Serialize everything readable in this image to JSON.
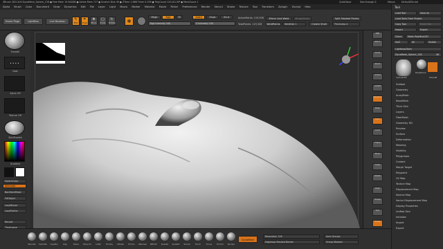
{
  "titlebar": {
    "text": "ZBrush 2021.6.6   DynaMesh_Sphere_128   ● Free Mem 19.900GB ● Active Mem 717 ● Scratch Disk 49 ● ZTime 1.866 Timer 0.299 ● PolyCount 120.014 KP ● MeshCount 1",
    "right": [
      "QuickSave",
      "See-through 0",
      "Menus",
      "DefaultZScript"
    ]
  },
  "menubar": [
    "Alpha",
    "Brush",
    "Color",
    "Document",
    "Draw",
    "Dynamics",
    "Edit",
    "File",
    "Layer",
    "Light",
    "Macro",
    "Marker",
    "Material",
    "Movie",
    "Picker",
    "Preferences",
    "Render",
    "Stencil",
    "Stroke",
    "Texture",
    "Tool",
    "Transform",
    "Zplugin",
    "Zscript",
    "Help"
  ],
  "toolbar": {
    "home_page": "Home Page",
    "lightbox": "LightBox",
    "live_boolean": "Live Boolean",
    "edit": "Edit",
    "draw": "Draw",
    "move": "Move",
    "scale": "Scale",
    "rotate": "Rotate",
    "mrgb": "Mrgb",
    "rgb": "Rgb",
    "m": "M",
    "zadd": "Zadd",
    "zsub": "Zsub",
    "zcut": "Zcut",
    "rgb_intensity": "Rgb Intensity 100",
    "z_intensity": "Z Intensity 100",
    "active_points": "ActivePoints: 119,528",
    "total_points": "TotalPoints: 119,528",
    "mirror_weld": "Mirror And Weld",
    "weld_points": "WeldPoints",
    "weld_dist": "WeldDist 1",
    "merge_down": "MergeDown",
    "create_shell": "Create Shell",
    "split_masked": "Split Masked Points",
    "thickness": "Thickness 4",
    "focal_shift": "Focal Shift 0",
    "draw_size": "Draw Size 64",
    "dynamic": "Dynamic"
  },
  "lefttray": {
    "brush_label": "Smooth",
    "stroke_label": "Dots",
    "alpha_label": "Alpha Off",
    "texture_label": "Texture Off",
    "material_label": "SkinShade4",
    "gradient_label": "Gradient",
    "switch_color": "SwitchColor",
    "alternate": "Alternate",
    "backface": "BackfaceMask",
    "flat_object": "FillObject",
    "lazy_mouse": "LazyMouse",
    "lazy_radius": "LazyRadius",
    "record": "Record",
    "timelapse": "TimeLapse",
    "turntable": "Turntable"
  },
  "rightshelf": [
    "BPR",
    "SPix 3",
    "Scroll",
    "Zoom",
    "Actual",
    "AAHalf",
    "Dynamic",
    "Persp",
    "Floor",
    "Local",
    "Frame",
    "Move",
    "Scale",
    "Rotate",
    "PolyF",
    "Transp",
    "Solo",
    "Xpose"
  ],
  "toolpal": {
    "title": "Tool",
    "load_tool": "Load Tool",
    "save_as": "Save As",
    "load_tools_project": "Load Tools From Project",
    "copy_tool": "Copy Tool",
    "paste_tool": "Paste Tool",
    "import": "Import",
    "export": "Export",
    "clone": "Clone",
    "make_polymesh": "Make PolyMesh3D",
    "goz": "GoZ",
    "all": "All",
    "visible": "Visible",
    "lightbox_tools": "Lightbox▸Tools",
    "current_tool": "DynaMesh_Sphere_128",
    "current_value": "48",
    "thumb1": "PolySphere",
    "thumb2": "SimpleB",
    "thumb3": "Cylinder3D",
    "items": [
      "Subtool",
      "Geometry",
      "ArrayMesh",
      "NanoMesh",
      "Thick Skin",
      "Layers",
      "FiberMesh",
      "Geometry HD",
      "Preview",
      "Surface",
      "Deformation",
      "Masking",
      "Visibility",
      "Polygroups",
      "Contact",
      "Morph Target",
      "Polypaint",
      "UV Map",
      "Texture Map",
      "Displacement Map",
      "Normal Map",
      "Vector Displacement Map",
      "Display Properties",
      "Unified Skin",
      "Initialize",
      "Import",
      "Export"
    ]
  },
  "bottombar": {
    "brushes": [
      "Standar",
      "DamSta",
      "ClayBui",
      "Clay",
      "Move",
      "Move To",
      "Inflat",
      "TrimDy",
      "hPolish",
      "TrimCu",
      "ZRemes",
      "IMM Pri",
      "Snakeh",
      "SnakeH",
      "Smoot",
      "Pinch",
      "Tonus",
      "TrimCir",
      "Sel Rec"
    ],
    "dynamesh": "DynaMesh",
    "resolution": "Resolution 128",
    "auto_groups": "Auto Groups",
    "edgeloop": "Edgeloop Masked Border",
    "group_masked": "Group Masked"
  },
  "colors": {
    "accent": "#e0881a",
    "skin": "#bdbdbd"
  }
}
